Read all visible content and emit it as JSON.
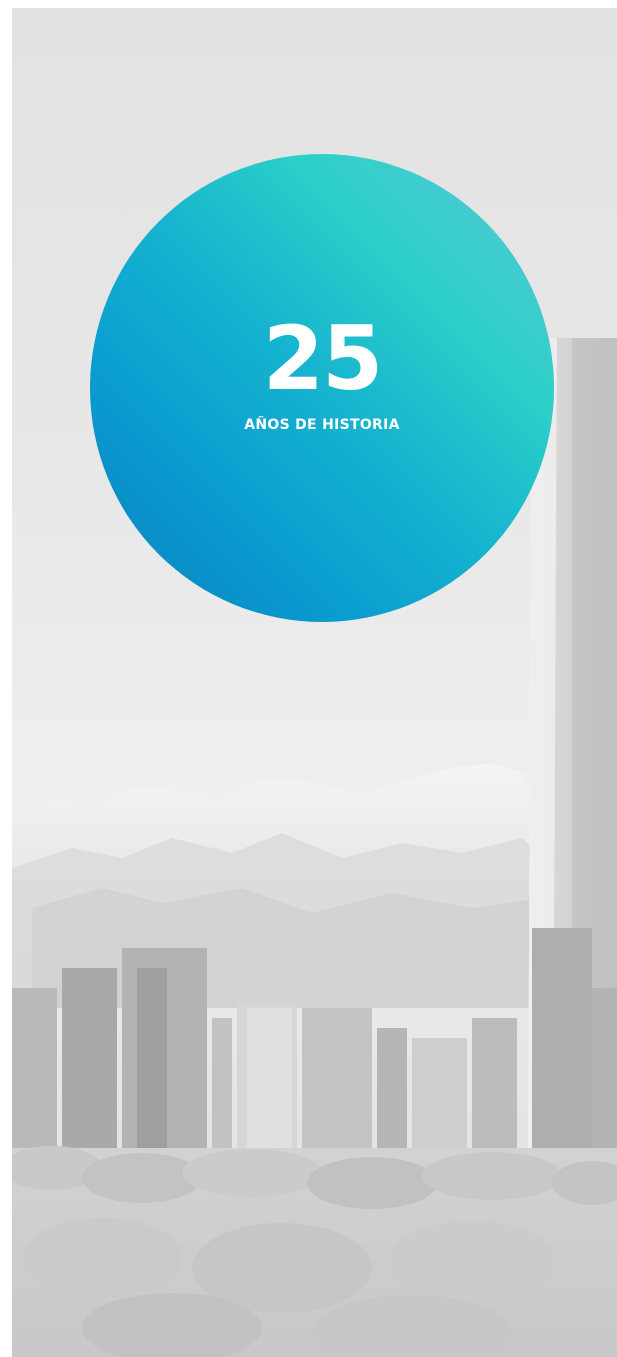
{
  "badge": {
    "number": "25",
    "caption": "AÑOS DE HISTORIA"
  },
  "colors": {
    "badge_light": "#2ccfc8",
    "badge_dark": "#0a7fbf",
    "text": "#ffffff",
    "background": "#e6e6e6"
  }
}
